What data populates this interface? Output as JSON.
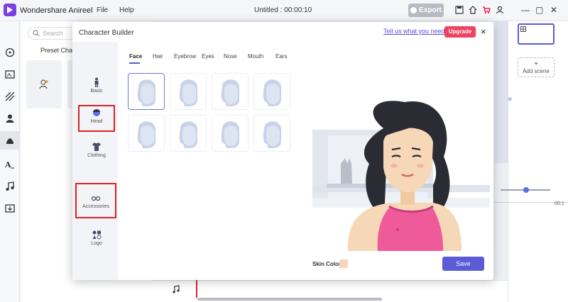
{
  "app": {
    "title": "Wondershare Anireel",
    "menu": [
      "File",
      "Help"
    ],
    "document_title": "Untitled : 00:00:10",
    "export_label": "Export"
  },
  "background": {
    "search_placeholder": "Search",
    "preset_label": "Preset Characte",
    "add_scene_label": "Add scene",
    "ruler_number": "00:1"
  },
  "modal": {
    "title": "Character Builder",
    "feedback_link": "Tell us what you need",
    "upgrade_label": "Upgrade",
    "close_label": "×",
    "categories": [
      {
        "label": "Basic",
        "icon": "body-icon",
        "selected": false
      },
      {
        "label": "Head",
        "icon": "head-icon",
        "selected": true
      },
      {
        "label": "Clothing",
        "icon": "shirt-icon",
        "selected": false
      },
      {
        "label": "Accessories",
        "icon": "glasses-icon",
        "selected": true
      },
      {
        "label": "Logo",
        "icon": "shapes-icon",
        "selected": false
      }
    ],
    "tabs": [
      "Face",
      "Hair",
      "Eyebrow",
      "Eyes",
      "Nose",
      "Mouth",
      "Ears"
    ],
    "active_tab": "Face",
    "face_count": 8,
    "skin_color_label": "Skin Color",
    "skin_color": "#f6d8b8",
    "save_label": "Save"
  },
  "colors": {
    "accent": "#5b5bd6",
    "upgrade": "#f0435f",
    "highlight": "#d22222"
  }
}
